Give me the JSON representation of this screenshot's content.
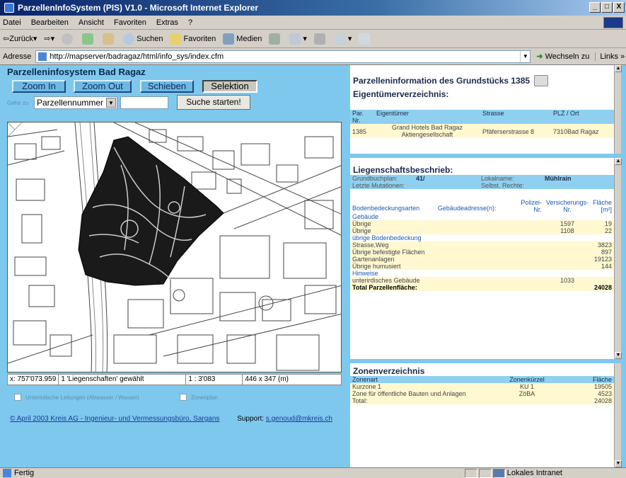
{
  "window": {
    "title": "ParzellenInfoSystem (PIS) V1.0 - Microsoft Internet Explorer",
    "buttons": [
      "_",
      "□",
      "X"
    ]
  },
  "menu": [
    "Datei",
    "Bearbeiten",
    "Ansicht",
    "Favoriten",
    "Extras",
    "?"
  ],
  "toolbar": {
    "back": "Zurück",
    "search": "Suchen",
    "favorites": "Favoriten",
    "media": "Medien"
  },
  "address": {
    "label": "Adresse",
    "url": "http://mapserver/badragaz/html/info_sys/index.cfm",
    "go": "Wechseln zu",
    "links": "Links »"
  },
  "left": {
    "title": "Parzelleninfosystem Bad Ragaz",
    "buttons": {
      "zoom_in": "Zoom In",
      "zoom_out": "Zoom Out",
      "pan": "Schieben",
      "select": "Selektion"
    },
    "goto_label": "Gehe zu",
    "select_value": "Parzellennummer",
    "search_button": "Suche starten!",
    "status": {
      "coords": "x: 757'073.959",
      "selection": "1 'Liegenschaften' gewählt",
      "scale": "1 : 3'083",
      "extent": "446 x 347 (m)"
    },
    "checkbox_1": "Unterirdische Leitungen (Abwasser / Wasser)",
    "checkbox_2": "Zonenplan",
    "footer_link": "© April 2003 Kreis AG - Ingenieur- und Vermessungsbüro, Sargans",
    "support_label": "Support:",
    "support_email": "s.genoud@mkreis.ch"
  },
  "right": {
    "title": "Parzelleninformation des Grundstücks 1385",
    "owners_title": "Eigentümerverzeichnis:",
    "owners_headers": [
      "Par. Nr.",
      "Eigentümer",
      "Strasse",
      "PLZ / Ort"
    ],
    "owners_row": {
      "nr": "1385",
      "owner_1": "Grand Hotels Bad Ragaz",
      "owner_2": "Aktiengesellschaft",
      "street": "Pfäferserstrasse 8",
      "city": "7310Bad Ragaz"
    },
    "desc_title": "Liegenschaftsbeschrieb:",
    "grundbuch_label": "Grundbuchplan:",
    "grundbuch_value": "41/",
    "lokal_label": "Lokalname:",
    "lokal_value": "Mühlrain",
    "mutationen_label": "Letzte Mutationen:",
    "selbst_label": "Selbst. Rechte:",
    "cover_headers": {
      "arten": "Bodenbedeckungsarten",
      "adresse": "Gebäudeadresse(n):",
      "polizei_1": "Polizei-",
      "polizei_2": "Nr.",
      "vers_1": "Versicherungs-",
      "vers_2": "Nr.",
      "flaeche_1": "Fläche",
      "flaeche_2": "[m²]"
    },
    "cover_rows": [
      {
        "label": "Gebäude",
        "vers": "",
        "area": "",
        "heading": true
      },
      {
        "label": "Übrige",
        "vers": "1597",
        "area": "19",
        "heading": false
      },
      {
        "label": "Übrige",
        "vers": "1108",
        "area": "22",
        "heading": false
      },
      {
        "label": "übrige Bodenbedeckung",
        "vers": "",
        "area": "",
        "heading": true
      },
      {
        "label": "Strasse,Weg",
        "vers": "",
        "area": "3823",
        "heading": false
      },
      {
        "label": "Übrige befestigte Flächen",
        "vers": "",
        "area": "897",
        "heading": false
      },
      {
        "label": "Gartenanlagen",
        "vers": "",
        "area": "19123",
        "heading": false
      },
      {
        "label": "Übrige humusiert",
        "vers": "",
        "area": "144",
        "heading": false
      },
      {
        "label": "Hinweise",
        "vers": "",
        "area": "",
        "heading": true
      },
      {
        "label": "unterirdisches Gebäude",
        "vers": "1033",
        "area": "",
        "heading": false
      }
    ],
    "total_label": "Total Parzellenfläche:",
    "total_value": "24028",
    "zones_title": "Zonenverzeichnis",
    "zones_headers": [
      "Zonenart",
      "Zonenkürzel",
      "Fläche"
    ],
    "zones_rows": [
      {
        "art": "Kurzone 1",
        "code": "KU 1",
        "area": "19505"
      },
      {
        "art": "Zone für öffentliche Bauten und Anlagen",
        "code": "ZöBA",
        "area": "4523"
      },
      {
        "art": "Total:",
        "code": "",
        "area": "24028"
      }
    ]
  },
  "statusbar": {
    "text": "Fertig",
    "zone": "Lokales Intranet"
  }
}
